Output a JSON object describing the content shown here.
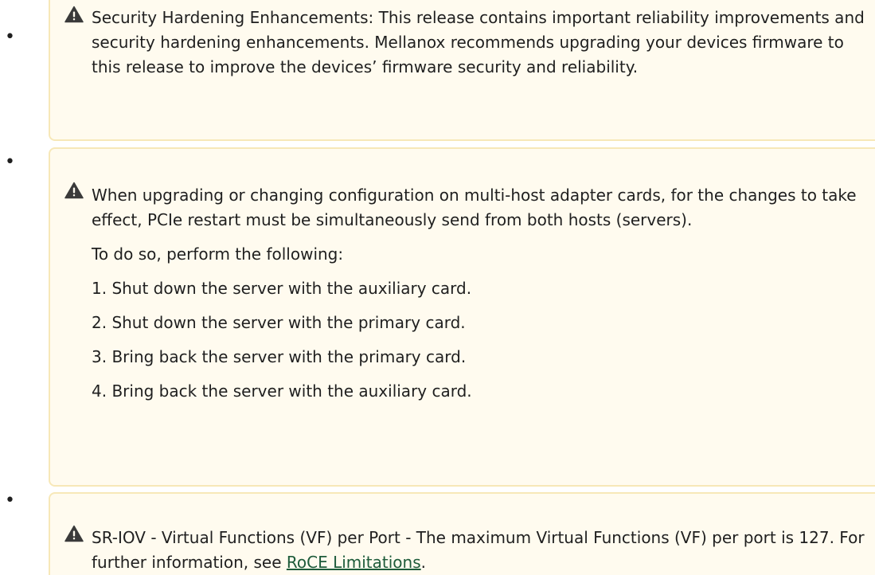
{
  "bullet_char": "•",
  "notes": [
    {
      "icon": "warning-triangle-icon",
      "text": "Security Hardening Enhancements: This release contains important reliability improvements and security hardening enhancements. Mellanox recommends upgrading your devices firmware to this release to improve the devices’ firmware security and reliability."
    },
    {
      "icon": "warning-triangle-icon",
      "text": "When upgrading or changing configuration on multi-host adapter cards, for the changes to take effect, PCIe restart must be simultaneously send from both hosts (servers).",
      "intro": "To do so, perform the following:",
      "steps": [
        "1. Shut down the server with the auxiliary card.",
        "2. Shut down the server with the primary card.",
        "3. Bring back the server with the primary card.",
        "4. Bring back the server with the auxiliary card."
      ]
    },
    {
      "icon": "warning-triangle-icon",
      "text_before_link": "SR-IOV - Virtual Functions (VF) per Port - The maximum Virtual Functions (VF) per port is 127. For further information, see ",
      "link_text": "RoCE Limitations",
      "text_after_link": "."
    }
  ],
  "colors": {
    "panel_bg": "#fffbef",
    "panel_border": "#f7e8b8",
    "icon": "#3a3a3a",
    "link": "#1d5b3a"
  }
}
